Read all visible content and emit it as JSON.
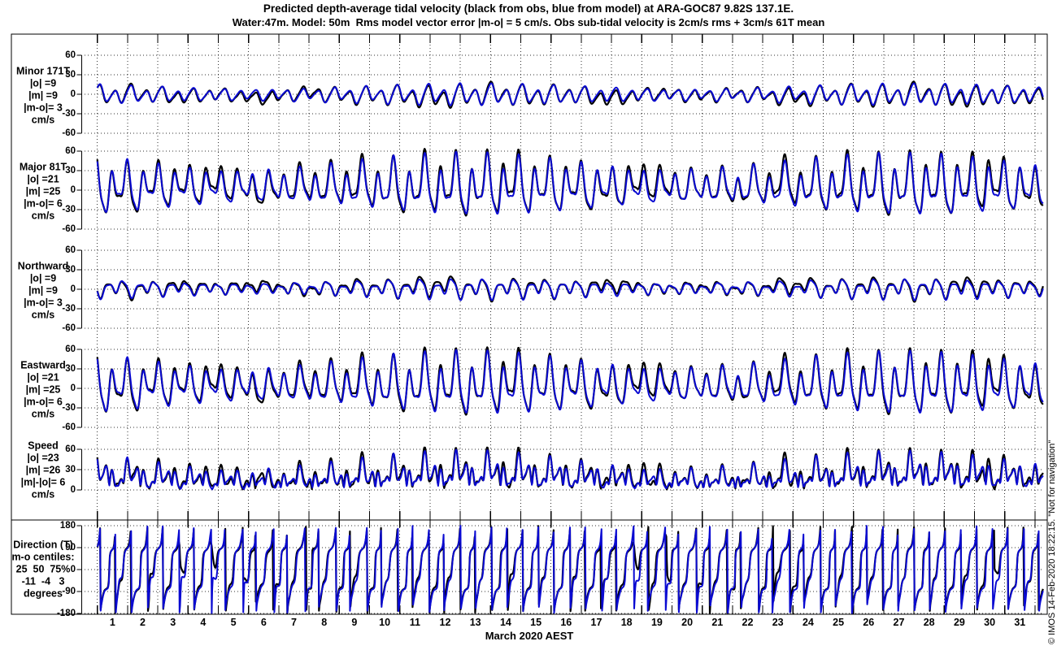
{
  "title": {
    "line1": "Predicted depth-average tidal velocity (black from obs, blue from model) at ARA-GOC87 9.82S 137.1E.",
    "line2": "Water:47m. Model: 50m  Rms model vector error |m-o| = 5 cm/s. Obs sub-tidal velocity is 2cm/s rms + 3cm/s 61T mean"
  },
  "watermark": "© IMOS 14-Feb-2020 18:22:15. \"Not for navigation\"",
  "colors": {
    "obs": "#000000",
    "model": "#0a0ad2",
    "grid": "#000000",
    "frame": "#000000"
  },
  "xaxis": {
    "label": "March 2020 AEST",
    "days": [
      "1",
      "2",
      "3",
      "4",
      "5",
      "6",
      "7",
      "8",
      "9",
      "10",
      "11",
      "12",
      "13",
      "14",
      "15",
      "16",
      "17",
      "18",
      "19",
      "20",
      "21",
      "22",
      "23",
      "24",
      "25",
      "26",
      "27",
      "28",
      "29",
      "30",
      "31"
    ]
  },
  "chart_data": {
    "type": "line",
    "x_range_days": [
      0,
      31.28
    ],
    "grid": true,
    "legend": "colors in title: black = observations, blue = model",
    "major_axis_bearing_deg": 81,
    "minor_axis_bearing_deg": 171,
    "panels": [
      {
        "id": "minor",
        "quantity": "minor",
        "labels": [
          "Minor 171T",
          "|o| =9",
          "|m| =9",
          "|m-o|= 3",
          "cm/s"
        ],
        "yticks": [
          60,
          30,
          0,
          -30,
          -60
        ],
        "ylim": [
          -66,
          66
        ]
      },
      {
        "id": "major",
        "quantity": "major",
        "labels": [
          "Major 81T",
          "|o| =21",
          "|m| =25",
          "|m-o|= 6",
          "cm/s"
        ],
        "yticks": [
          60,
          30,
          0,
          -30,
          -60
        ],
        "ylim": [
          -66,
          66
        ]
      },
      {
        "id": "northward",
        "quantity": "north",
        "labels": [
          "Northward",
          "|o| =9",
          "|m| =9",
          "|m-o|= 3",
          "cm/s"
        ],
        "yticks": [
          60,
          30,
          0,
          -30,
          -60
        ],
        "ylim": [
          -66,
          66
        ]
      },
      {
        "id": "eastward",
        "quantity": "east",
        "labels": [
          "Eastward",
          "|o| =21",
          "|m| =25",
          "|m-o|= 6",
          "cm/s"
        ],
        "yticks": [
          60,
          30,
          0,
          -30,
          -60
        ],
        "ylim": [
          -66,
          66
        ]
      },
      {
        "id": "speed",
        "quantity": "speed",
        "labels": [
          "Speed",
          "|o| =23",
          "|m| =26",
          "|m|-|o|= 6",
          "cm/s"
        ],
        "yticks": [
          60,
          30,
          0
        ],
        "ylim": [
          -2,
          64
        ]
      },
      {
        "id": "direction",
        "quantity": "direction",
        "labels": [
          "Direction (T)",
          "m-o centiles:",
          "25  50  75%",
          "-11  -4   3",
          "degrees"
        ],
        "yticks": [
          180,
          90,
          0,
          -90,
          -180
        ],
        "ylim": [
          -184,
          184
        ]
      }
    ],
    "series": [
      {
        "name": "obs",
        "color_key": "obs"
      },
      {
        "name": "model",
        "color_key": "model"
      }
    ],
    "signal": {
      "sample_step_days": 0.018,
      "spring": {
        "period_days": 14.77,
        "center_day": 12.5,
        "fraction": 0.28
      },
      "model": {
        "east": {
          "mean": 4.0,
          "constituents": [
            {
              "period_days": 0.5175,
              "amp": 26.0,
              "phase": 0.3,
              "spring": true
            },
            {
              "period_days": 0.2588,
              "amp": 7.0,
              "phase": 1.2,
              "spring": true
            },
            {
              "period_days": 0.9973,
              "amp": 11.0,
              "phase": 1.1
            },
            {
              "period_days": 1.0758,
              "amp": 5.0,
              "phase": 0.4
            }
          ]
        },
        "north": {
          "mean": 1.5,
          "constituents": [
            {
              "period_days": 0.5175,
              "amp": 8.5,
              "phase": 2.0,
              "spring": true
            },
            {
              "period_days": 0.2588,
              "amp": 2.2,
              "phase": 0.5,
              "spring": true
            },
            {
              "period_days": 0.9973,
              "amp": 4.0,
              "phase": 2.3
            },
            {
              "period_days": 1.0758,
              "amp": 2.0,
              "phase": 1.5
            }
          ]
        }
      },
      "obs": {
        "east": {
          "mean": 6.0,
          "constituents": [
            {
              "period_days": 0.5175,
              "amp": 27.0,
              "phase": 0.38,
              "spring": true
            },
            {
              "period_days": 0.2588,
              "amp": 7.5,
              "phase": 1.3,
              "spring": true
            },
            {
              "period_days": 0.9973,
              "amp": 11.5,
              "phase": 1.18
            },
            {
              "period_days": 1.0758,
              "amp": 5.2,
              "phase": 0.46
            },
            {
              "period_days": 2.3,
              "amp": 3.0,
              "phase": 1.0
            },
            {
              "period_days": 5.1,
              "amp": 2.5,
              "phase": 2.4
            },
            {
              "period_days": 3.7,
              "amp": 2.0,
              "phase": 0.2
            }
          ]
        },
        "north": {
          "mean": 2.8,
          "constituents": [
            {
              "period_days": 0.5175,
              "amp": 9.0,
              "phase": 2.08,
              "spring": true
            },
            {
              "period_days": 0.2588,
              "amp": 2.4,
              "phase": 0.58
            },
            {
              "period_days": 0.9973,
              "amp": 4.3,
              "phase": 2.38
            },
            {
              "period_days": 1.0758,
              "amp": 2.1,
              "phase": 1.58
            },
            {
              "period_days": 2.9,
              "amp": 2.0,
              "phase": 0.7
            },
            {
              "period_days": 6.3,
              "amp": 1.5,
              "phase": 1.9
            }
          ]
        }
      }
    }
  }
}
